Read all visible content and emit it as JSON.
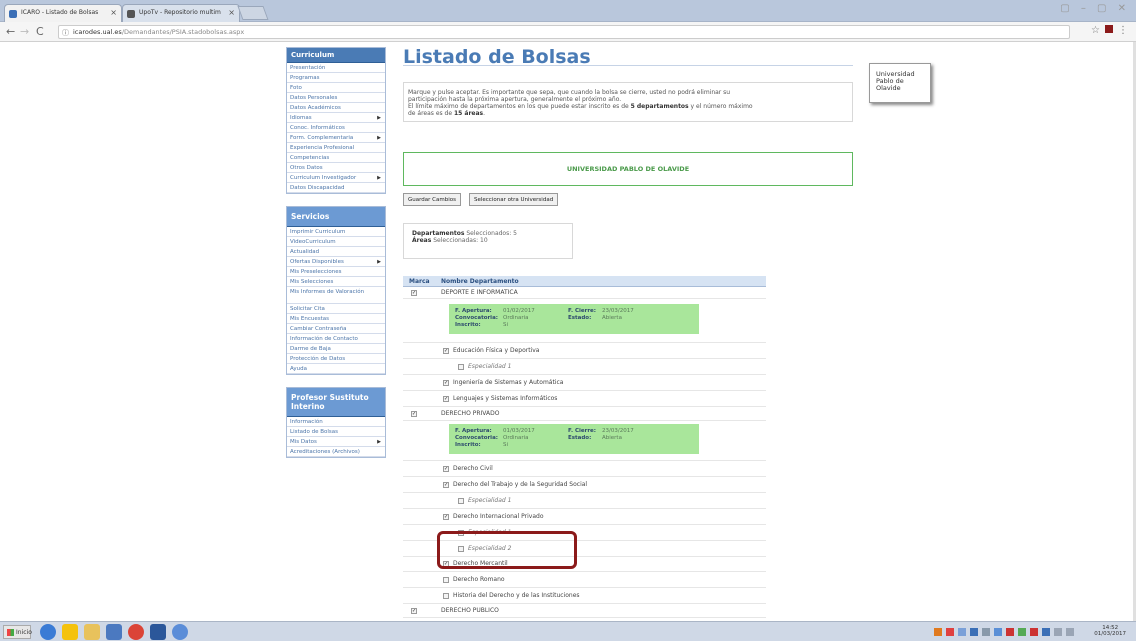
{
  "browser": {
    "tabs": [
      {
        "label": "ICARO - Listado de Bolsas",
        "active": true
      },
      {
        "label": "UpoTv - Repositorio multim",
        "active": false
      }
    ],
    "url_host": "icarodes.ual.es",
    "url_path": "/Demandantes/PSIA.stadobolsas.aspx"
  },
  "sidebar": {
    "curriculum": {
      "heading": "Curriculum",
      "items": [
        "Presentación",
        "Programas",
        "Foto",
        "Datos Personales",
        "Datos Académicos",
        "Idiomas",
        "Conoc. Informáticos",
        "Form. Complementaria",
        "Experiencia Profesional",
        "Competencias",
        "Otros Datos",
        "Curriculum Investigador",
        "Datos Discapacidad"
      ]
    },
    "servicios": {
      "heading": "Servicios",
      "items": [
        "Imprimir Curriculum",
        "VideoCurriculum",
        "Actualidad",
        "Ofertas Disponibles",
        "Mis Preselecciones",
        "Mis Selecciones",
        "Mis Informes de Valoración",
        "Solicitar Cita",
        "Mis Encuestas",
        "Cambiar Contraseña",
        "Información de Contacto",
        "Darme de Baja",
        "Protección de Datos",
        "Ayuda"
      ]
    },
    "profesor": {
      "heading": "Profesor Sustituto Interino",
      "items": [
        "Información",
        "Listado de Bolsas",
        "Mis Datos",
        "Acreditaciones (Archivos)"
      ]
    }
  },
  "main": {
    "title": "Listado de Bolsas",
    "notice_line1": "Marque y pulse aceptar. Es importante que sepa, que cuando la bolsa se cierre, usted no podrá eliminar su",
    "notice_line2": "participación hasta la próxima apertura, generalmente el próximo año.",
    "notice_line3a": "El límite máximo de departamentos en los que puede estar inscrito es de ",
    "notice_line3b": "5 departamentos",
    "notice_line3c": " y el número máximo",
    "notice_line4a": "de áreas es de ",
    "notice_line4b": "15 áreas",
    "notice_line4c": ".",
    "university": "UNIVERSIDAD PABLO DE OLAVIDE",
    "btn_save": "Guardar Cambios",
    "btn_other": "Seleccionar otra Universidad",
    "sel_dept_label": "Departamentos",
    "sel_dept_value": " Seleccionados: 5",
    "sel_area_label": "Áreas",
    "sel_area_value": " Seleccionadas: 10",
    "col_mark": "Marca",
    "col_name": "Nombre Departamento",
    "info_labels": {
      "apertura": "F. Apertura:",
      "convocatoria": "Convocatoria:",
      "inscrito": "Inscrito:",
      "cierre": "F. Cierre:",
      "estado": "Estado:"
    },
    "dept1": {
      "name": "DEPORTE E INFORMATICA",
      "apertura": "01/02/2017",
      "convocatoria": "Ordinaria",
      "inscrito": "Si",
      "cierre": "23/03/2017",
      "estado": "Abierta"
    },
    "dept1_areas": [
      "Educación Física y Deportiva",
      "Especialidad 1",
      "Ingeniería de Sistemas y Automática",
      "Lenguajes y Sistemas Informáticos"
    ],
    "dept2": {
      "name": "DERECHO PRIVADO",
      "apertura": "01/03/2017",
      "convocatoria": "Ordinaria",
      "inscrito": "Si",
      "cierre": "23/03/2017",
      "estado": "Abierta"
    },
    "dept2_areas": [
      "Derecho Civil",
      "Derecho del Trabajo y de la Seguridad Social",
      "Especialidad 1",
      "Derecho Internacional Privado",
      "Especialidad 1",
      "Especialidad 2",
      "Derecho Mercantil",
      "Derecho Romano",
      "Historia del Derecho y de las Instituciones"
    ],
    "dept3": {
      "name": "DERECHO PUBLICO"
    }
  },
  "vendor": {
    "line1": "Universidad",
    "line2": "Pablo de",
    "line3": "Olavide"
  },
  "taskbar": {
    "start": "Inicio",
    "time": "14:52",
    "date": "01/03/2017"
  }
}
